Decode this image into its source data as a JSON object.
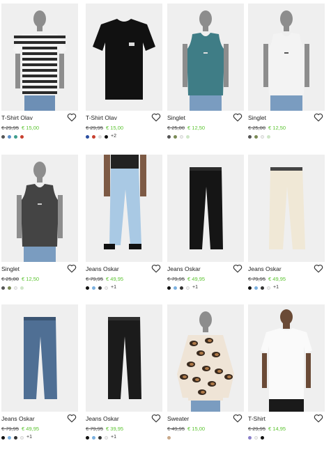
{
  "products": [
    {
      "name": "T-Shirt Olav",
      "old_price": "€ 29,95",
      "new_price": "€ 15,00",
      "swatches": [
        "#555555",
        "#5b8fc9",
        "#3e9e8c",
        "#c8402f"
      ],
      "more": "",
      "kind": "tee-striped"
    },
    {
      "name": "T-Shirt Olav",
      "old_price": "€ 29,95",
      "new_price": "€ 15,00",
      "swatches": [
        "#2b4fa0",
        "#c8402f",
        "#dddddd",
        "#111111"
      ],
      "more": "+2",
      "kind": "tee-black"
    },
    {
      "name": "Singlet",
      "old_price": "€ 25,00",
      "new_price": "€ 12,50",
      "swatches": [
        "#555555",
        "#7a8a55",
        "#f0f0f0",
        "#cfe6c8"
      ],
      "more": "",
      "kind": "singlet-teal"
    },
    {
      "name": "Singlet",
      "old_price": "€ 25,00",
      "new_price": "€ 12,50",
      "swatches": [
        "#555555",
        "#7a8a55",
        "#f0f0f0",
        "#cfe6c8"
      ],
      "more": "",
      "kind": "singlet-white"
    },
    {
      "name": "Singlet",
      "old_price": "€ 25,00",
      "new_price": "€ 12,50",
      "swatches": [
        "#555555",
        "#7a8a55",
        "#f0f0f0",
        "#cfe6c8"
      ],
      "more": "",
      "kind": "singlet-dark"
    },
    {
      "name": "Jeans Oskar",
      "old_price": "€ 79,95",
      "new_price": "€ 49,95",
      "swatches": [
        "#111111",
        "#7ab0e0",
        "#333333",
        "#f2f2f2"
      ],
      "more": "+1",
      "kind": "jeans-light-model"
    },
    {
      "name": "Jeans Oskar",
      "old_price": "€ 79,95",
      "new_price": "€ 49,95",
      "swatches": [
        "#111111",
        "#7ab0e0",
        "#333333",
        "#f2f2f2"
      ],
      "more": "+1",
      "kind": "jeans-black"
    },
    {
      "name": "Jeans Oskar",
      "old_price": "€ 79,95",
      "new_price": "€ 49,95",
      "swatches": [
        "#111111",
        "#7ab0e0",
        "#333333",
        "#f2f2f2"
      ],
      "more": "+1",
      "kind": "jeans-cream"
    },
    {
      "name": "Jeans Oskar",
      "old_price": "€ 79,95",
      "new_price": "€ 49,95",
      "swatches": [
        "#111111",
        "#7ab0e0",
        "#333333",
        "#f2f2f2"
      ],
      "more": "+1",
      "kind": "jeans-blue"
    },
    {
      "name": "Jeans Oskar",
      "old_price": "€ 79,95",
      "new_price": "€ 39,95",
      "swatches": [
        "#111111",
        "#7ab0e0",
        "#333333",
        "#f2f2f2"
      ],
      "more": "+1",
      "kind": "jeans-black2"
    },
    {
      "name": "Sweater",
      "old_price": "€ 49,95",
      "new_price": "€ 15,00",
      "swatches": [
        "#c9a98a"
      ],
      "more": "",
      "kind": "sweater-leopard"
    },
    {
      "name": "T-Shirt",
      "old_price": "€ 29,95",
      "new_price": "€ 14,95",
      "swatches": [
        "#8a7fc9",
        "#f2f2f2",
        "#111111"
      ],
      "more": "",
      "kind": "tee-white-model"
    }
  ]
}
